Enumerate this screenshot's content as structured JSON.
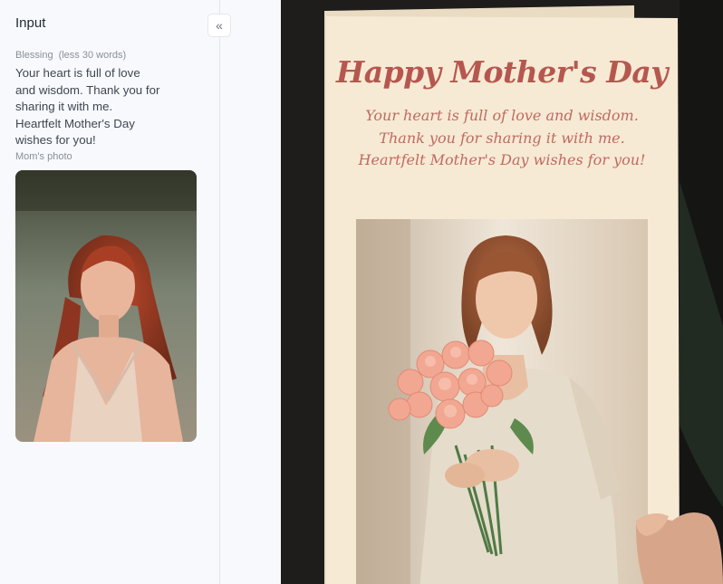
{
  "sidebar": {
    "title": "Input",
    "collapse_icon": "double-chevron-left-icon",
    "blessing": {
      "label": "Blessing",
      "hint": "(less 30 words)",
      "lines": [
        "Your heart is full of love",
        "and wisdom. Thank you for",
        "sharing it with me.",
        "Heartfelt Mother's Day",
        "wishes for you!"
      ]
    },
    "photo": {
      "label": "Mom's photo"
    }
  },
  "card": {
    "title": "Happy Mother's Day",
    "lines": [
      "Your heart is full of love and wisdom.",
      "Thank you for sharing it with me.",
      "Heartfelt Mother's Day wishes for you!"
    ]
  },
  "colors": {
    "sidebar_bg": "#f7f9fc",
    "card_paper": "#f6ead4",
    "card_title": "#b6574f",
    "card_text": "#c06a61"
  }
}
